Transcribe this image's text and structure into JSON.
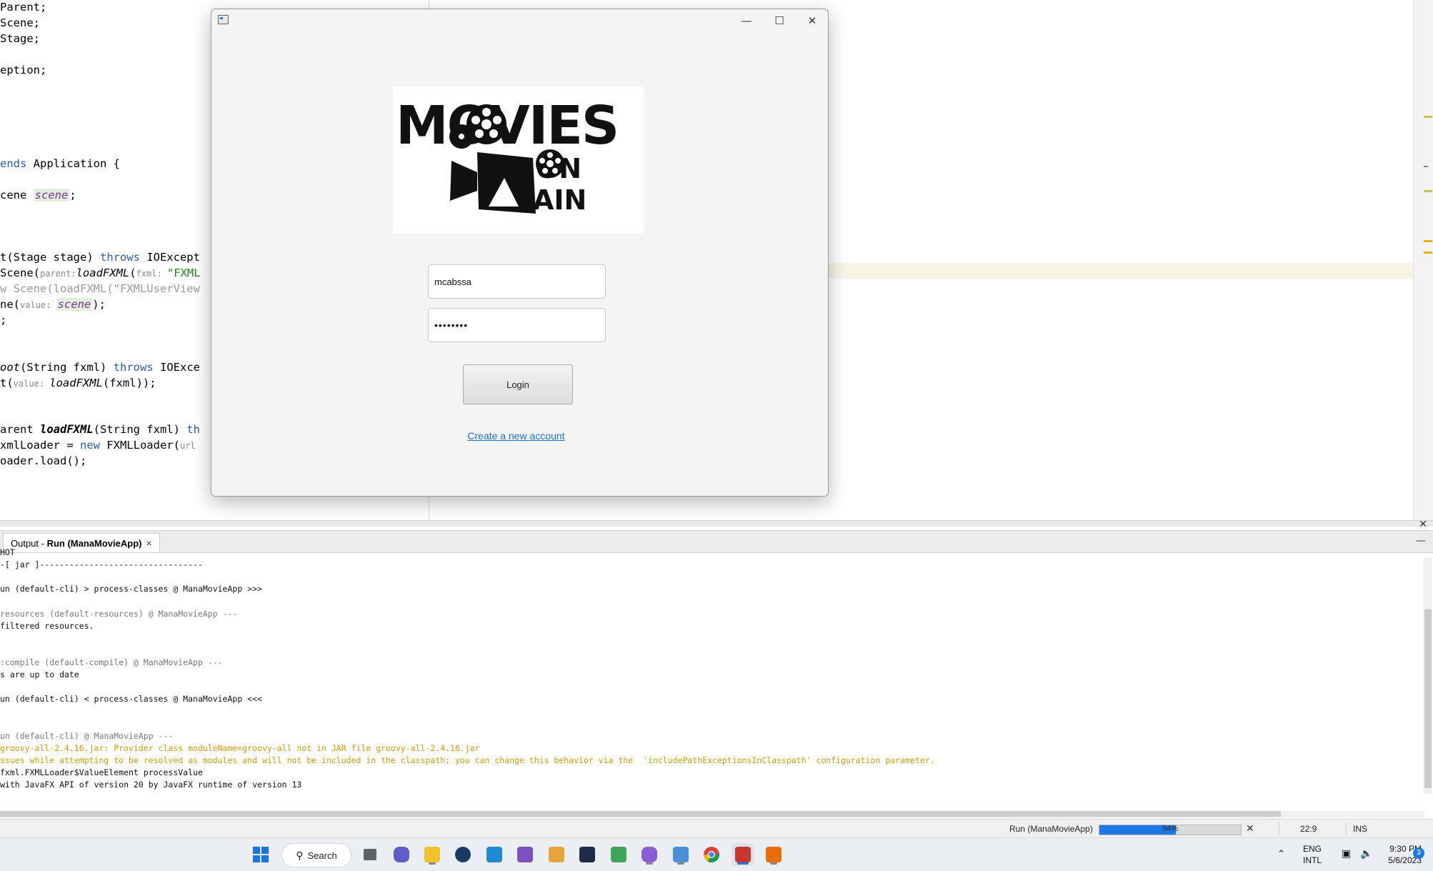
{
  "editor": {
    "code_lines": [
      {
        "parts": [
          {
            "t": "Parent;"
          }
        ]
      },
      {
        "parts": [
          {
            "t": "Scene;"
          }
        ]
      },
      {
        "parts": [
          {
            "t": "Stage;"
          }
        ]
      },
      {
        "parts": [
          {
            "t": ""
          }
        ]
      },
      {
        "parts": [
          {
            "t": "eption;"
          }
        ]
      },
      {
        "parts": [
          {
            "t": ""
          }
        ]
      },
      {
        "parts": [
          {
            "t": ""
          }
        ]
      },
      {
        "parts": [
          {
            "t": ""
          }
        ]
      },
      {
        "parts": [
          {
            "t": ""
          }
        ]
      },
      {
        "parts": [
          {
            "t": ""
          }
        ]
      },
      {
        "parts": [
          {
            "t": "ends",
            "c": "kw"
          },
          {
            "t": " Application {"
          }
        ]
      },
      {
        "parts": [
          {
            "t": ""
          }
        ]
      },
      {
        "parts": [
          {
            "t": "cene "
          },
          {
            "t": "scene",
            "c": "fld"
          },
          {
            "t": ";"
          }
        ]
      },
      {
        "parts": [
          {
            "t": ""
          }
        ]
      },
      {
        "parts": [
          {
            "t": ""
          }
        ]
      },
      {
        "parts": [
          {
            "t": ""
          }
        ]
      },
      {
        "parts": [
          {
            "t": "t(Stage stage) "
          },
          {
            "t": "throws",
            "c": "kw"
          },
          {
            "t": " IOExcept"
          }
        ]
      },
      {
        "parts": [
          {
            "t": "Scene("
          },
          {
            "t": "parent:",
            "c": "hint"
          },
          {
            "t": "loadFXML",
            "c": "it"
          },
          {
            "t": "("
          },
          {
            "t": "fxml: ",
            "c": "hint"
          },
          {
            "t": "\"FXML",
            "c": "str"
          }
        ]
      },
      {
        "parts": [
          {
            "t": "w Scene(loadFXML(\"FXMLUserView",
            "c": "dim"
          }
        ]
      },
      {
        "parts": [
          {
            "t": "ne("
          },
          {
            "t": "value: ",
            "c": "hint"
          },
          {
            "t": "scene",
            "c": "fld"
          },
          {
            "t": ");"
          }
        ]
      },
      {
        "parts": [
          {
            "t": ";"
          }
        ]
      },
      {
        "parts": [
          {
            "t": ""
          }
        ]
      },
      {
        "parts": [
          {
            "t": ""
          }
        ]
      },
      {
        "parts": [
          {
            "t": "oot",
            "c": "it"
          },
          {
            "t": "(String fxml) "
          },
          {
            "t": "throws",
            "c": "kw"
          },
          {
            "t": " IOExce"
          }
        ]
      },
      {
        "parts": [
          {
            "t": "t("
          },
          {
            "t": "value: ",
            "c": "hint"
          },
          {
            "t": "loadFXML",
            "c": "it"
          },
          {
            "t": "(fxml));"
          }
        ]
      },
      {
        "parts": [
          {
            "t": ""
          }
        ]
      },
      {
        "parts": [
          {
            "t": ""
          }
        ]
      },
      {
        "parts": [
          {
            "t": "arent "
          },
          {
            "t": "loadFXML",
            "c": "bi"
          },
          {
            "t": "(String fxml) "
          },
          {
            "t": "th",
            "c": "kw"
          }
        ]
      },
      {
        "parts": [
          {
            "t": "xmlLoader = "
          },
          {
            "t": "new",
            "c": "kw"
          },
          {
            "t": " FXMLLoader("
          },
          {
            "t": "url",
            "c": "hint"
          }
        ]
      },
      {
        "parts": [
          {
            "t": "oader.load();"
          }
        ]
      }
    ]
  },
  "dialog": {
    "logo_text_line1": "MOVIES",
    "logo_text_line2": "ON",
    "logo_text_line3": "AIN",
    "username_value": "mcabssa",
    "password_value": "••••••••",
    "login_label": "Login",
    "create_account_label": "Create a new account",
    "minimize_glyph": "—",
    "maximize_glyph": "☐",
    "close_glyph": "✕"
  },
  "output": {
    "tab_prefix": "Output - ",
    "tab_name": "Run (ManaMovieApp)",
    "tab_close": "×",
    "minimize_glyph": "—",
    "lines": [
      {
        "t": "HOT",
        "c": ""
      },
      {
        "t": "-[ jar ]---------------------------------",
        "c": ""
      },
      {
        "t": "",
        "c": ""
      },
      {
        "t": "un (default-cli) > process-classes @ ManaMovieApp >>>",
        "c": ""
      },
      {
        "t": "",
        "c": ""
      },
      {
        "t": "resources (default-resources) @ ManaMovieApp ---",
        "c": "gray"
      },
      {
        "t": "filtered resources.",
        "c": ""
      },
      {
        "t": "",
        "c": ""
      },
      {
        "t": "",
        "c": ""
      },
      {
        "t": ":compile (default-compile) @ ManaMovieApp ---",
        "c": "gray"
      },
      {
        "t": "s are up to date",
        "c": ""
      },
      {
        "t": "",
        "c": ""
      },
      {
        "t": "un (default-cli) < process-classes @ ManaMovieApp <<<",
        "c": ""
      },
      {
        "t": "",
        "c": ""
      },
      {
        "t": "",
        "c": ""
      },
      {
        "t": "un (default-cli) @ ManaMovieApp ---",
        "c": "gray"
      },
      {
        "t": "groovy-all-2.4.16.jar: Provider class moduleName=groovy-all not in JAR file groovy-all-2.4.16.jar",
        "c": "warn"
      },
      {
        "t": "ssues while attempting to be resolved as modules and will not be included in the classpath; you can change this behavior via the  'includePathExceptionsInClasspath' configuration parameter.",
        "c": "warn"
      },
      {
        "t": "fxml.FXMLLoader$ValueElement processValue",
        "c": ""
      },
      {
        "t": "with JavaFX API of version 20 by JavaFX runtime of version 13",
        "c": ""
      }
    ]
  },
  "status": {
    "run_label": "Run (ManaMovieApp)",
    "progress_text": "54%",
    "progress_fraction": 0.54,
    "cancel_glyph": "✕",
    "caret_position": "22:9",
    "insert_mode": "INS",
    "close_glyph": "✕"
  },
  "taskbar": {
    "search_label": "Search",
    "lang_top": "ENG",
    "lang_bottom": "INTL",
    "time": "9:30 PM",
    "date": "5/6/2023",
    "notification_count": "3"
  },
  "colors": {
    "accent": "#1e78e6",
    "link": "#1a73c9",
    "keyword": "#2a5db0",
    "warning": "#d99a00"
  }
}
